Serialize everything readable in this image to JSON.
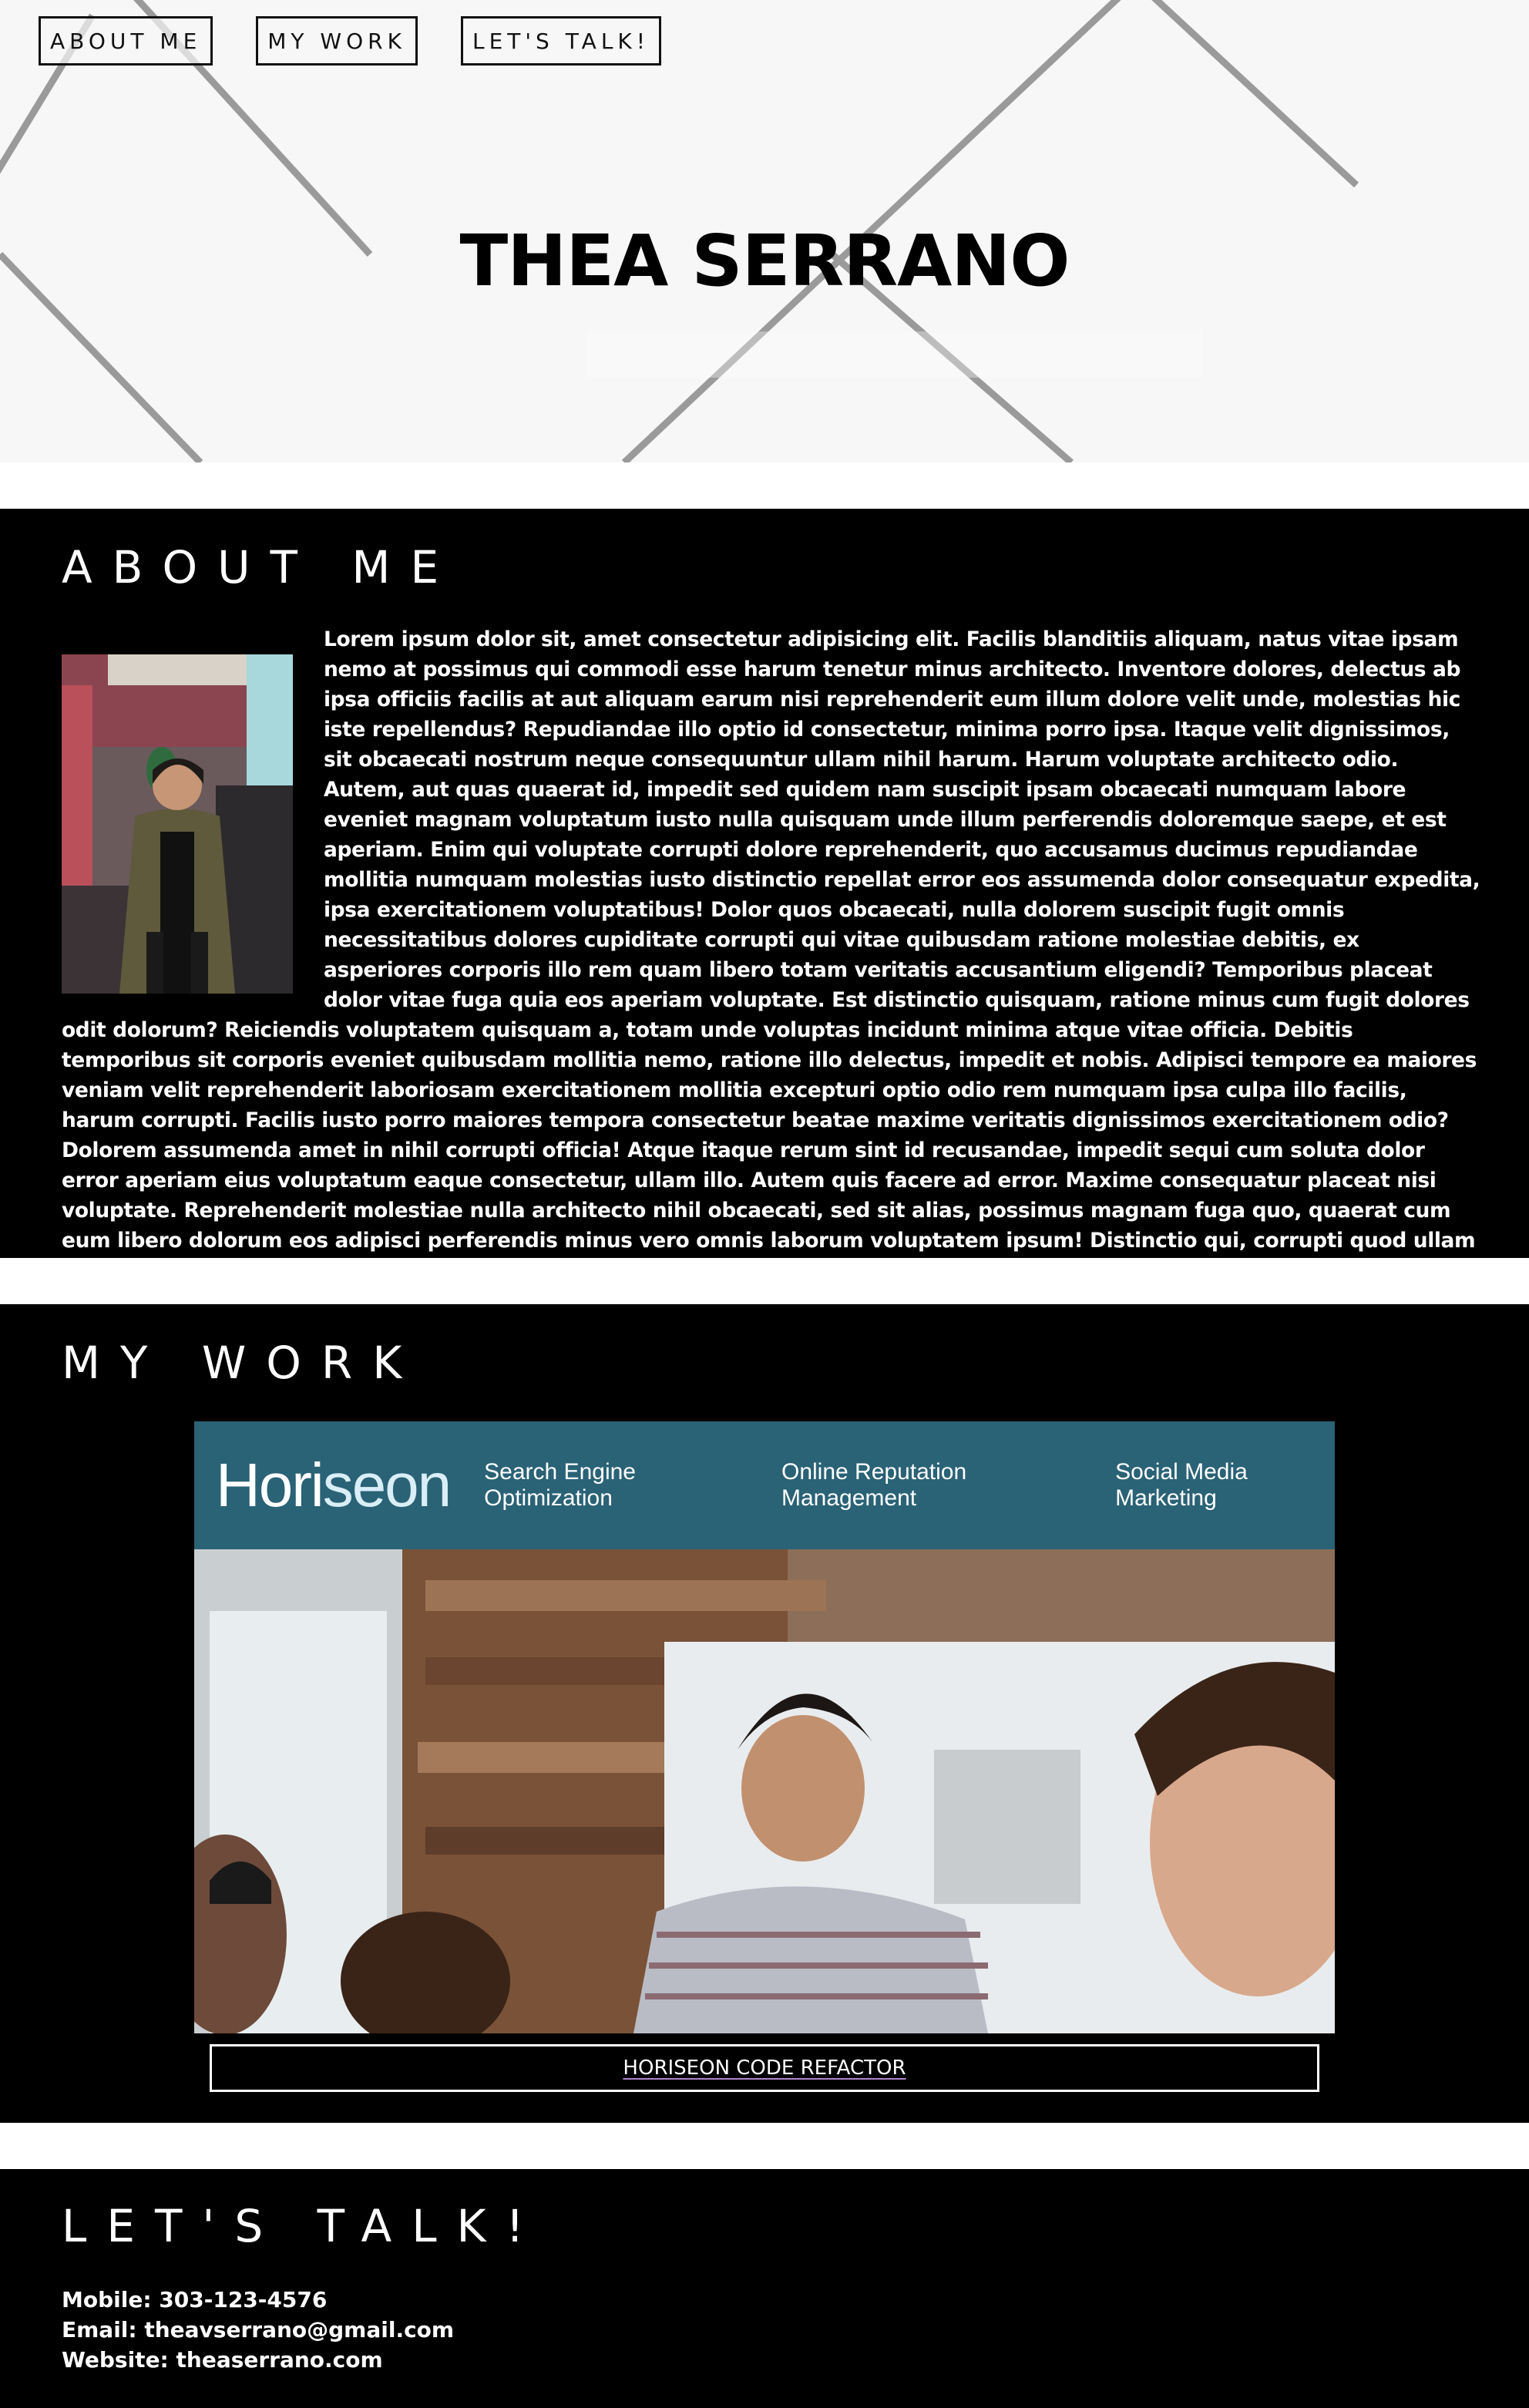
{
  "nav": {
    "about": "ABOUT ME",
    "work": "MY WORK",
    "talk": "LET'S TALK!"
  },
  "hero": {
    "name": "THEA SERRANO"
  },
  "about": {
    "heading": "ABOUT ME",
    "body": "Lorem ipsum dolor sit, amet consectetur adipisicing elit. Facilis blanditiis aliquam, natus vitae ipsam nemo at possimus qui commodi esse harum tenetur minus architecto. Inventore dolores, delectus ab ipsa officiis facilis at aut aliquam earum nisi reprehenderit eum illum dolore velit unde, molestias hic iste repellendus? Repudiandae illo optio id consectetur, minima porro ipsa. Itaque velit dignissimos, sit obcaecati nostrum neque consequuntur ullam nihil harum. Harum voluptate architecto odio. Autem, aut quas quaerat id, impedit sed quidem nam suscipit ipsam obcaecati numquam labore eveniet magnam voluptatum iusto nulla quisquam unde illum perferendis doloremque saepe, et est aperiam. Enim qui voluptate corrupti dolore reprehenderit, quo accusamus ducimus repudiandae mollitia numquam molestias iusto distinctio repellat error eos assumenda dolor consequatur expedita, ipsa exercitationem voluptatibus! Dolor quos obcaecati, nulla dolorem suscipit fugit omnis necessitatibus dolores cupiditate corrupti qui vitae quibusdam ratione molestiae debitis, ex asperiores corporis illo rem quam libero totam veritatis accusantium eligendi? Temporibus placeat dolor vitae fuga quia eos aperiam voluptate. Est distinctio quisquam, ratione minus cum fugit dolores odit dolorum? Reiciendis voluptatem quisquam a, totam unde voluptas incidunt minima atque vitae officia. Debitis temporibus sit corporis eveniet quibusdam mollitia nemo, ratione illo delectus, impedit et nobis. Adipisci tempore ea maiores veniam velit reprehenderit laboriosam exercitationem mollitia excepturi optio odio rem numquam ipsa culpa illo facilis, harum corrupti. Facilis iusto porro maiores tempora consectetur beatae maxime veritatis dignissimos exercitationem odio? Dolorem assumenda amet in nihil corrupti officia! Atque itaque rerum sint id recusandae, impedit sequi cum soluta dolor error aperiam eius voluptatum eaque consectetur, ullam illo. Autem quis facere ad error. Maxime consequatur placeat nisi voluptate. Reprehenderit molestiae nulla architecto nihil obcaecati, sed sit alias, possimus magnam fuga quo, quaerat cum eum libero dolorum eos adipisci perferendis minus vero omnis laborum voluptatem ipsum! Distinctio qui, corrupti quod ullam expedita itaque perspiciatis."
  },
  "work": {
    "heading": "MY WORK",
    "project": {
      "logo_main": "Hori",
      "logo_accent": "seon",
      "nav": [
        "Search Engine Optimization",
        "Online Reputation Management",
        "Social Media Marketing"
      ],
      "link_label": "HORISEON CODE REFACTOR"
    }
  },
  "contact": {
    "heading": "LET'S TALK!",
    "mobile": "Mobile: 303-123-4576",
    "email": "Email: theavserrano@gmail.com",
    "website": "Website: theaserrano.com"
  },
  "colors": {
    "section_bg": "#000000",
    "hero_bg": "#f7f7f7",
    "project_header": "#2a6276"
  }
}
